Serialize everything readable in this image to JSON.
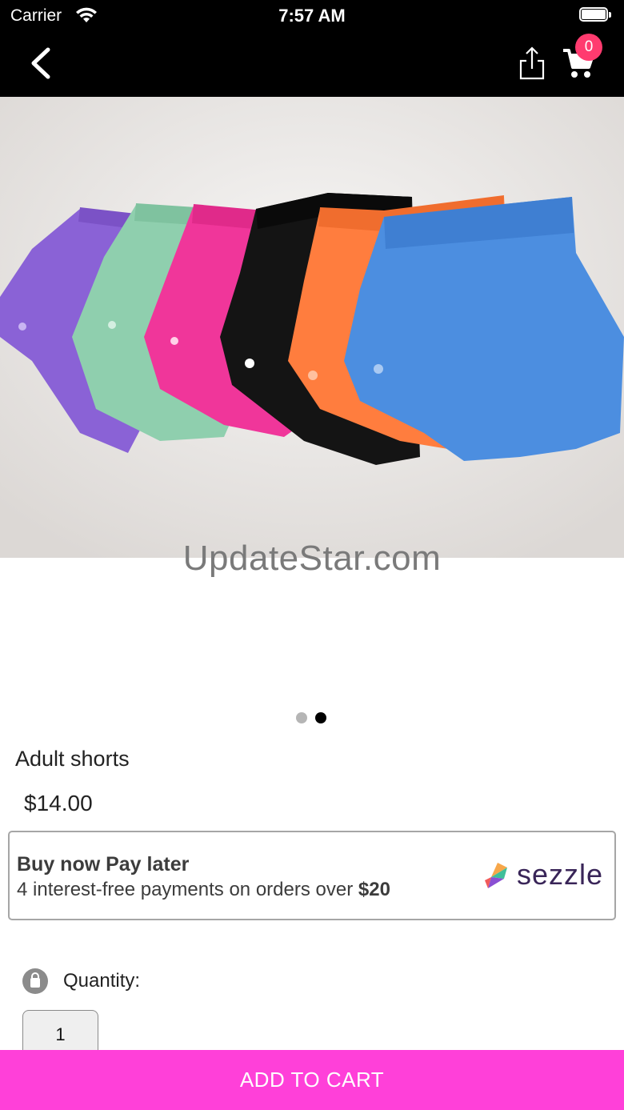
{
  "status_bar": {
    "carrier": "Carrier",
    "time": "7:57 AM"
  },
  "nav": {
    "back_icon": "chevron-left-icon",
    "share_icon": "share-icon",
    "cart_icon": "cart-icon",
    "cart_count": "0"
  },
  "product": {
    "image_description_icon": "product-photo",
    "watermark": "UpdateStar.com",
    "pager_total": 2,
    "pager_active": 2,
    "title": "Adult shorts",
    "price": "$14.00"
  },
  "sezzle": {
    "headline": "Buy now Pay later",
    "subline_prefix": "4 interest-free payments on orders over ",
    "subline_amount": "$20",
    "brand": "sezzle"
  },
  "quantity": {
    "label": "Quantity:",
    "value": "1"
  },
  "actions": {
    "add_to_cart": "ADD TO CART"
  },
  "colors": {
    "topbar": "#000000",
    "badge": "#ff3b6f",
    "cta": "#ff40d9",
    "short_colors": [
      "#8a62d6",
      "#8fcfae",
      "#f0369a",
      "#141414",
      "#ff7d3e",
      "#4c8ee0"
    ]
  }
}
